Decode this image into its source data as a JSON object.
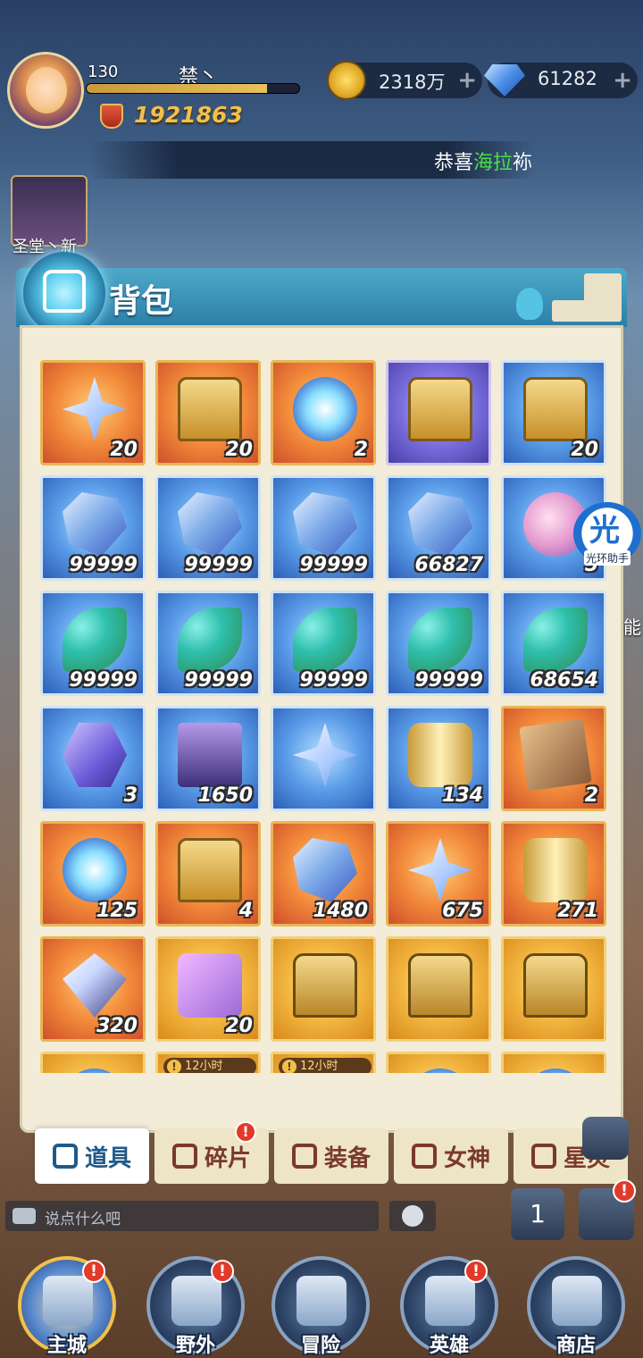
{
  "player": {
    "level": "130",
    "name": "禁丶",
    "exp_fraction": 0.85,
    "power": "1921863"
  },
  "currency": {
    "gold": "2318万",
    "gems": "61282",
    "plus": "+"
  },
  "marquee": {
    "prefix": "恭喜",
    "highlight": "海拉",
    "tail": "袮"
  },
  "side": {
    "avatar_label": "圣堂丶新"
  },
  "bag": {
    "title": "背包",
    "items": [
      {
        "icon": "star-shard-icon",
        "count": "20",
        "rarity": "orange",
        "shape": "star"
      },
      {
        "icon": "pet-chest-icon",
        "count": "20",
        "rarity": "orange",
        "shape": "chest"
      },
      {
        "icon": "crystal-orb-icon",
        "count": "2",
        "rarity": "orange",
        "shape": "orb"
      },
      {
        "icon": "silver-chest-icon",
        "count": "",
        "rarity": "purple",
        "shape": "chest"
      },
      {
        "icon": "cube-chest-icon",
        "count": "20",
        "rarity": "blue",
        "shape": "chest"
      },
      {
        "icon": "blue-crystal-icon",
        "count": "99999",
        "rarity": "blue",
        "shape": "crystal"
      },
      {
        "icon": "blue-crystal-icon",
        "count": "99999",
        "rarity": "blue",
        "shape": "crystal"
      },
      {
        "icon": "blue-crystal-icon",
        "count": "99999",
        "rarity": "blue",
        "shape": "crystal"
      },
      {
        "icon": "blue-crystal-icon",
        "count": "66827",
        "rarity": "blue",
        "shape": "crystal"
      },
      {
        "icon": "peach-fruit-icon",
        "count": "5",
        "rarity": "blue",
        "shape": "peach"
      },
      {
        "icon": "spirit-leaf-icon",
        "count": "99999",
        "rarity": "blue",
        "shape": "leaf"
      },
      {
        "icon": "spirit-leaf-icon",
        "count": "99999",
        "rarity": "blue",
        "shape": "leaf"
      },
      {
        "icon": "spirit-leaf-icon",
        "count": "99999",
        "rarity": "blue",
        "shape": "leaf"
      },
      {
        "icon": "spirit-leaf-icon",
        "count": "99999",
        "rarity": "blue",
        "shape": "leaf"
      },
      {
        "icon": "spirit-leaf-icon",
        "count": "68654",
        "rarity": "blue",
        "shape": "leaf"
      },
      {
        "icon": "rune-stone-icon",
        "count": "3",
        "rarity": "blue",
        "shape": "hex"
      },
      {
        "icon": "rune-scroll-icon",
        "count": "1650",
        "rarity": "blue",
        "shape": "scroll"
      },
      {
        "icon": "star-rune-icon",
        "count": "",
        "rarity": "blue",
        "shape": "star"
      },
      {
        "icon": "golden-scroll-icon",
        "count": "134",
        "rarity": "blue",
        "shape": "cylinder"
      },
      {
        "icon": "mystery-card-icon",
        "count": "2",
        "rarity": "orange",
        "shape": "card"
      },
      {
        "icon": "star-orb-icon",
        "count": "125",
        "rarity": "orange",
        "shape": "orb"
      },
      {
        "icon": "sun-chest-icon",
        "count": "4",
        "rarity": "orange",
        "shape": "chest"
      },
      {
        "icon": "dark-crystal-icon",
        "count": "1480",
        "rarity": "orange",
        "shape": "crystal"
      },
      {
        "icon": "star-shard-icon",
        "count": "675",
        "rarity": "orange",
        "shape": "star"
      },
      {
        "icon": "stone-scroll-icon",
        "count": "271",
        "rarity": "orange",
        "shape": "cylinder"
      },
      {
        "icon": "prism-diamond-icon",
        "count": "320",
        "rarity": "orange",
        "shape": "diamond"
      },
      {
        "icon": "helmet-puzzle-icon",
        "count": "20",
        "rarity": "gold",
        "shape": "puzzle"
      },
      {
        "icon": "treasure-chest-icon",
        "count": "",
        "rarity": "gold",
        "shape": "treasure"
      },
      {
        "icon": "treasure-chest-icon",
        "count": "",
        "rarity": "gold",
        "shape": "treasure"
      },
      {
        "icon": "jewel-chest-icon",
        "count": "",
        "rarity": "gold",
        "shape": "treasure"
      },
      {
        "icon": "gold-item-icon",
        "count": "",
        "rarity": "gold",
        "shape": "orb",
        "timer": ""
      },
      {
        "icon": "timed-chest-icon",
        "count": "",
        "rarity": "gold",
        "shape": "treasure",
        "timer": "12小时"
      },
      {
        "icon": "timed-chest-icon",
        "count": "",
        "rarity": "gold",
        "shape": "treasure",
        "timer": "12小时"
      },
      {
        "icon": "gold-item-icon",
        "count": "",
        "rarity": "gold",
        "shape": "orb",
        "timer": ""
      },
      {
        "icon": "gold-item-icon",
        "count": "",
        "rarity": "gold",
        "shape": "orb",
        "timer": ""
      }
    ],
    "tabs": [
      {
        "label": "道具",
        "icon": "items-tab-icon",
        "active": true,
        "badge": ""
      },
      {
        "label": "碎片",
        "icon": "shards-tab-icon",
        "active": false,
        "badge": "!"
      },
      {
        "label": "装备",
        "icon": "equipment-tab-icon",
        "active": false,
        "badge": ""
      },
      {
        "label": "女神",
        "icon": "goddess-tab-icon",
        "active": false,
        "badge": ""
      },
      {
        "label": "星灵",
        "icon": "star-spirit-tab-icon",
        "active": false,
        "badge": ""
      }
    ]
  },
  "helper": {
    "char": "光",
    "label": "光环助手"
  },
  "side_text": "能",
  "chat": {
    "placeholder": "说点什么吧"
  },
  "rank_button": "1",
  "bottom_nav": [
    {
      "label": "主城",
      "icon": "castle-icon",
      "active": true,
      "badge": "!"
    },
    {
      "label": "野外",
      "icon": "portal-icon",
      "active": false,
      "badge": "!"
    },
    {
      "label": "冒险",
      "icon": "sword-arch-icon",
      "active": false,
      "badge": ""
    },
    {
      "label": "英雄",
      "icon": "helmet-icon",
      "active": false,
      "badge": "!"
    },
    {
      "label": "商店",
      "icon": "shop-icon",
      "active": false,
      "badge": ""
    }
  ],
  "badge_text": "!"
}
